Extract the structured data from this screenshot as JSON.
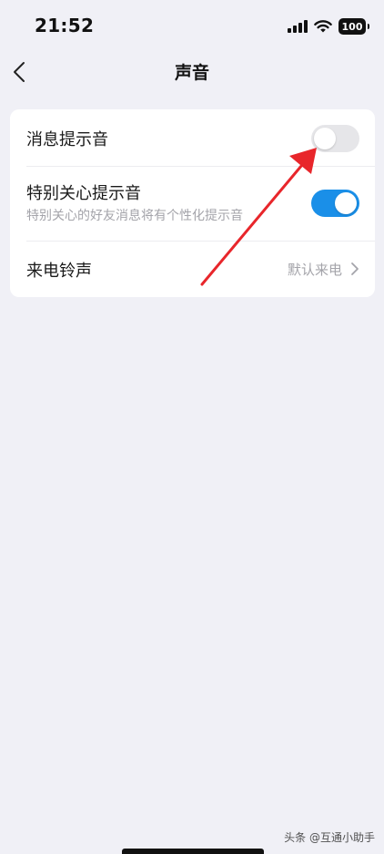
{
  "status_bar": {
    "time": "21:52",
    "battery": "100",
    "icons": [
      "signal-icon",
      "wifi-icon",
      "battery-icon"
    ]
  },
  "nav": {
    "title": "声音",
    "back_icon": "chevron-left-icon"
  },
  "settings": {
    "message_tone": {
      "label": "消息提示音",
      "enabled": false
    },
    "special_care_tone": {
      "label": "特别关心提示音",
      "description": "特别关心的好友消息将有个性化提示音",
      "enabled": true
    },
    "ringtone": {
      "label": "来电铃声",
      "value": "默认来电"
    }
  },
  "watermark": "头条 @互通小助手",
  "colors": {
    "background": "#f0f0f6",
    "card": "#ffffff",
    "toggle_on": "#1a8fe8",
    "toggle_off": "#e6e6e9",
    "annotation_arrow": "#e8262b",
    "secondary_text": "#a4a4aa"
  }
}
